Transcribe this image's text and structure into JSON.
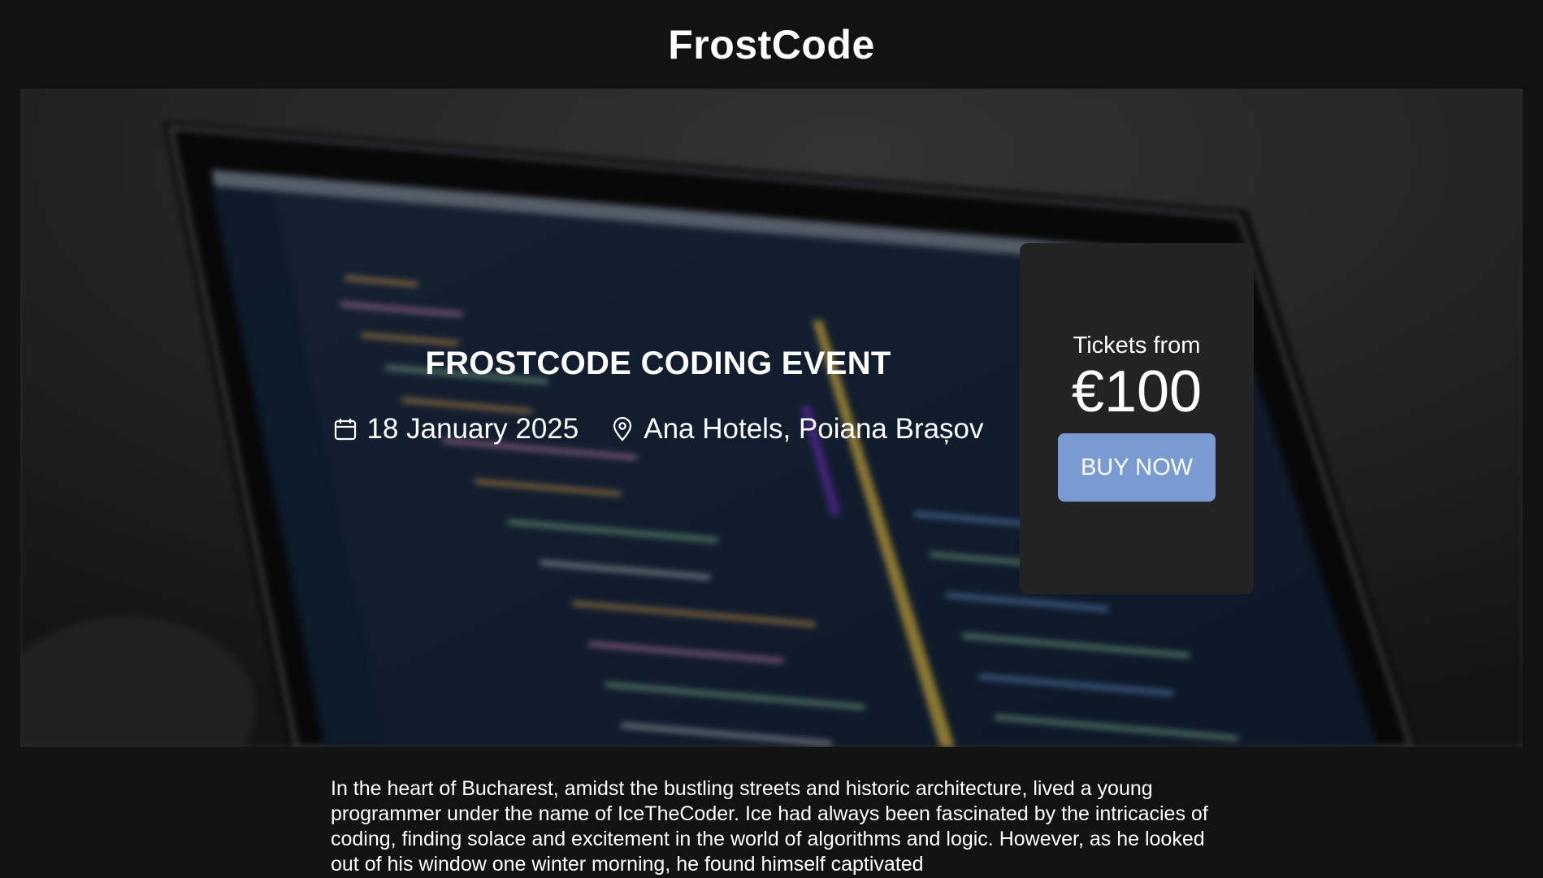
{
  "header": {
    "title": "FrostCode"
  },
  "hero": {
    "background_icon": "laptop-code-photo",
    "event_title": "FROSTCODE CODING EVENT",
    "date_icon": "calendar-icon",
    "date": "18 January 2025",
    "location_icon": "location-pin-icon",
    "location": "Ana Hotels, Poiana Brașov"
  },
  "ticket": {
    "label": "Tickets from",
    "price": "€100",
    "buy_label": "BUY NOW",
    "button_color": "#7a9bd1"
  },
  "story": {
    "text": "In the heart of Bucharest, amidst the bustling streets and historic architecture, lived a young programmer under the name of IceTheCoder. Ice had always been fascinated by the intricacies of coding, finding solace and excitement in the world of algorithms and logic. However, as he looked out of his window one winter morning, he found himself captivated"
  },
  "colors": {
    "page_background": "#121212",
    "card_background": "#232323",
    "text": "#ffffff"
  }
}
